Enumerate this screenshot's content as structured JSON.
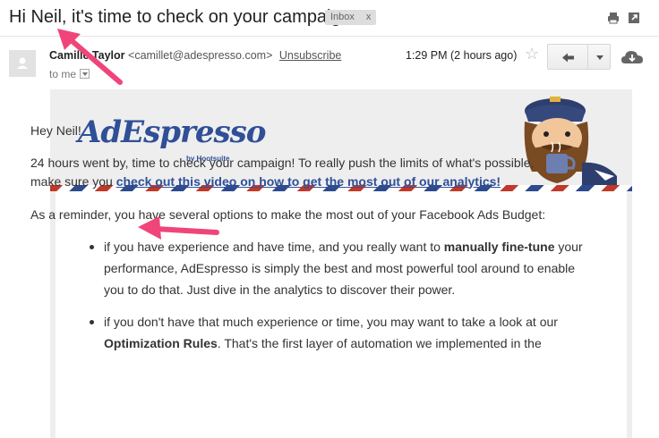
{
  "subject": "Hi Neil, it's time to check on your campaign!",
  "label_chip": {
    "text": "Inbox",
    "close": "x"
  },
  "sender": {
    "name": "Camille Taylor",
    "email": "<camillet@adespresso.com>",
    "unsubscribe": "Unsubscribe"
  },
  "to_line": "to me",
  "timestamp": "1:29 PM (2 hours ago)",
  "brand": {
    "logo_text": "AdEspresso",
    "byline": "by Hootsuite"
  },
  "body": {
    "greeting": "Hey Neil!",
    "p1_text": "24 hours went by, time to check your campaign! To really push the limits of what's possible, make sure you ",
    "p1_link": "check out this video on how to get the most out of our analytics!",
    "p2": "As a reminder, you have several options to make the most out of your Facebook Ads Budget:",
    "bullet1_pre": "if you have experience and have time, and you really want to ",
    "bullet1_bold": "manually fine-tune",
    "bullet1_post": " your performance, AdEspresso is simply the best and most powerful tool around to enable you to do that. Just dive in the analytics to discover their power.",
    "bullet2_pre": "if you don't have that much experience or time, you may want to take a look at our ",
    "bullet2_bold": "Optimization Rules",
    "bullet2_post": ". That's the first layer of automation we implemented in the"
  },
  "colors": {
    "brand_blue": "#2f4f97",
    "arrow_pink": "#f0457a",
    "airmail_red": "#c0392b"
  },
  "icons": [
    "print-icon",
    "new-window-icon",
    "avatar-icon",
    "star-icon",
    "reply-icon",
    "more-dropdown-icon",
    "cloud-download-icon"
  ]
}
